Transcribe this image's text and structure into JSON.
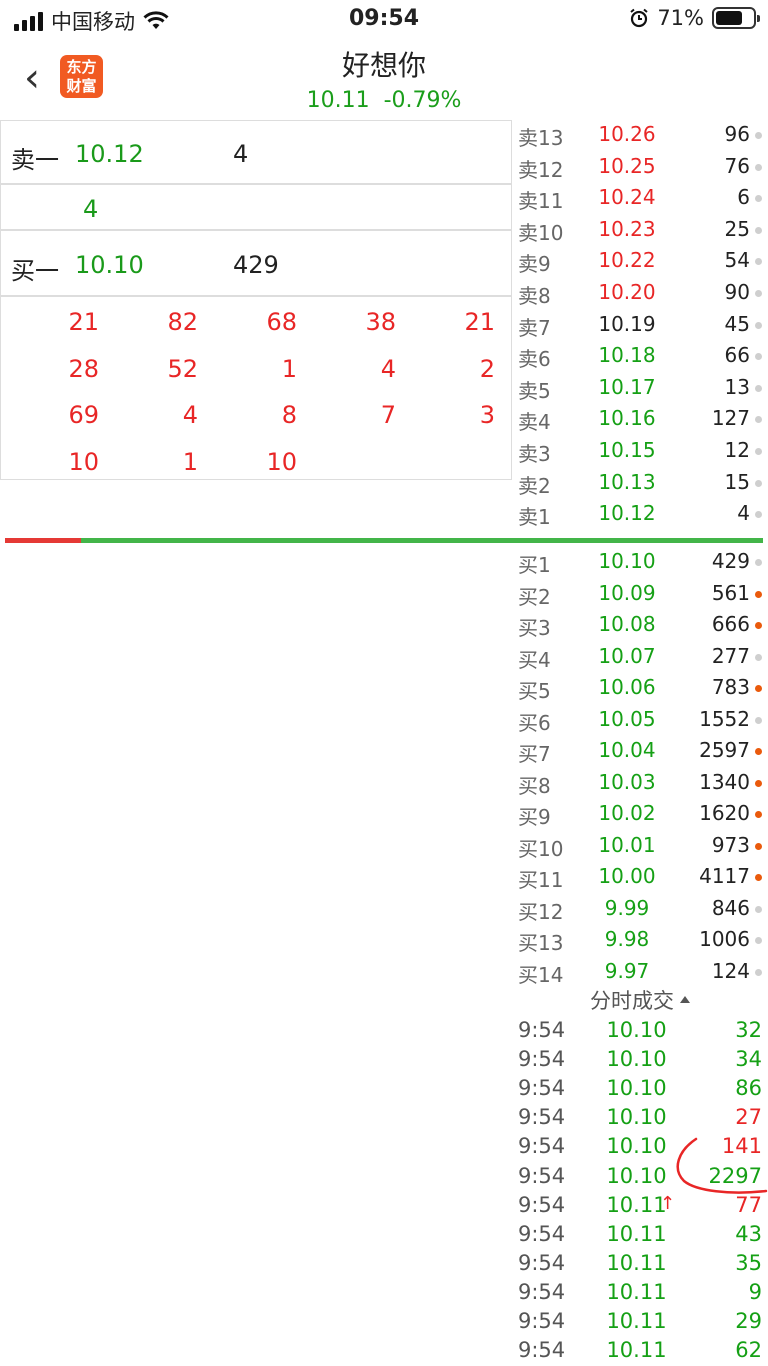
{
  "status_bar": {
    "carrier": "中国移动",
    "time": "09:54",
    "battery": "71%",
    "battery_level": 0.71
  },
  "header": {
    "title": "好想你",
    "price": "10.11",
    "change": "-0.79%",
    "logo_text_1": "东方",
    "logo_text_2": "财富"
  },
  "left_panel": {
    "sell_label": "卖一",
    "sell_price": "10.12",
    "sell_volume": "4",
    "sell_queue_volume": "4",
    "buy_label": "买一",
    "buy_price": "10.10",
    "buy_volume": "429",
    "queue": [
      [
        "21",
        "82",
        "68",
        "38",
        "21"
      ],
      [
        "28",
        "52",
        "1",
        "4",
        "2"
      ],
      [
        "69",
        "4",
        "8",
        "7",
        "3"
      ],
      [
        "10",
        "1",
        "10"
      ]
    ]
  },
  "depth": {
    "asks": [
      {
        "label": "卖13",
        "price": "10.26",
        "volume": "96",
        "color": "red",
        "dot": "grey"
      },
      {
        "label": "卖12",
        "price": "10.25",
        "volume": "76",
        "color": "red",
        "dot": "grey"
      },
      {
        "label": "卖11",
        "price": "10.24",
        "volume": "6",
        "color": "red",
        "dot": "grey"
      },
      {
        "label": "卖10",
        "price": "10.23",
        "volume": "25",
        "color": "red",
        "dot": "grey"
      },
      {
        "label": "卖9",
        "price": "10.22",
        "volume": "54",
        "color": "red",
        "dot": "grey"
      },
      {
        "label": "卖8",
        "price": "10.20",
        "volume": "90",
        "color": "red",
        "dot": "grey"
      },
      {
        "label": "卖7",
        "price": "10.19",
        "volume": "45",
        "color": "black",
        "dot": "grey"
      },
      {
        "label": "卖6",
        "price": "10.18",
        "volume": "66",
        "color": "green",
        "dot": "grey"
      },
      {
        "label": "卖5",
        "price": "10.17",
        "volume": "13",
        "color": "green",
        "dot": "grey"
      },
      {
        "label": "卖4",
        "price": "10.16",
        "volume": "127",
        "color": "green",
        "dot": "grey"
      },
      {
        "label": "卖3",
        "price": "10.15",
        "volume": "12",
        "color": "green",
        "dot": "grey"
      },
      {
        "label": "卖2",
        "price": "10.13",
        "volume": "15",
        "color": "green",
        "dot": "grey"
      },
      {
        "label": "卖1",
        "price": "10.12",
        "volume": "4",
        "color": "green",
        "dot": "grey"
      }
    ],
    "bids": [
      {
        "label": "买1",
        "price": "10.10",
        "volume": "429",
        "color": "green",
        "dot": "grey"
      },
      {
        "label": "买2",
        "price": "10.09",
        "volume": "561",
        "color": "green",
        "dot": "orange"
      },
      {
        "label": "买3",
        "price": "10.08",
        "volume": "666",
        "color": "green",
        "dot": "orange"
      },
      {
        "label": "买4",
        "price": "10.07",
        "volume": "277",
        "color": "green",
        "dot": "grey"
      },
      {
        "label": "买5",
        "price": "10.06",
        "volume": "783",
        "color": "green",
        "dot": "orange"
      },
      {
        "label": "买6",
        "price": "10.05",
        "volume": "1552",
        "color": "green",
        "dot": "grey"
      },
      {
        "label": "买7",
        "price": "10.04",
        "volume": "2597",
        "color": "green",
        "dot": "orange"
      },
      {
        "label": "买8",
        "price": "10.03",
        "volume": "1340",
        "color": "green",
        "dot": "orange"
      },
      {
        "label": "买9",
        "price": "10.02",
        "volume": "1620",
        "color": "green",
        "dot": "orange"
      },
      {
        "label": "买10",
        "price": "10.01",
        "volume": "973",
        "color": "green",
        "dot": "orange"
      },
      {
        "label": "买11",
        "price": "10.00",
        "volume": "4117",
        "color": "green",
        "dot": "orange"
      },
      {
        "label": "买12",
        "price": "9.99",
        "volume": "846",
        "color": "green",
        "dot": "grey"
      },
      {
        "label": "买13",
        "price": "9.98",
        "volume": "1006",
        "color": "green",
        "dot": "grey"
      },
      {
        "label": "买14",
        "price": "9.97",
        "volume": "124",
        "color": "green",
        "dot": "grey"
      }
    ],
    "ratio_bar": {
      "sell_fraction": 0.1,
      "sell_color": "#e53935",
      "buy_color": "#43b549"
    }
  },
  "ticks": {
    "title": "分时成交",
    "rows": [
      {
        "time": "9:54",
        "price": "10.10",
        "volume": "32",
        "vcolor": "green"
      },
      {
        "time": "9:54",
        "price": "10.10",
        "volume": "34",
        "vcolor": "green"
      },
      {
        "time": "9:54",
        "price": "10.10",
        "volume": "86",
        "vcolor": "green"
      },
      {
        "time": "9:54",
        "price": "10.10",
        "volume": "27",
        "vcolor": "red"
      },
      {
        "time": "9:54",
        "price": "10.10",
        "volume": "141",
        "vcolor": "red"
      },
      {
        "time": "9:54",
        "price": "10.10",
        "volume": "2297",
        "vcolor": "green"
      },
      {
        "time": "9:54",
        "price": "10.11",
        "volume": "77",
        "vcolor": "red",
        "arrow": "↑"
      },
      {
        "time": "9:54",
        "price": "10.11",
        "volume": "43",
        "vcolor": "green"
      },
      {
        "time": "9:54",
        "price": "10.11",
        "volume": "35",
        "vcolor": "green"
      },
      {
        "time": "9:54",
        "price": "10.11",
        "volume": "9",
        "vcolor": "green"
      },
      {
        "time": "9:54",
        "price": "10.11",
        "volume": "29",
        "vcolor": "green"
      },
      {
        "time": "9:54",
        "price": "10.11",
        "volume": "62",
        "vcolor": "green"
      }
    ]
  }
}
